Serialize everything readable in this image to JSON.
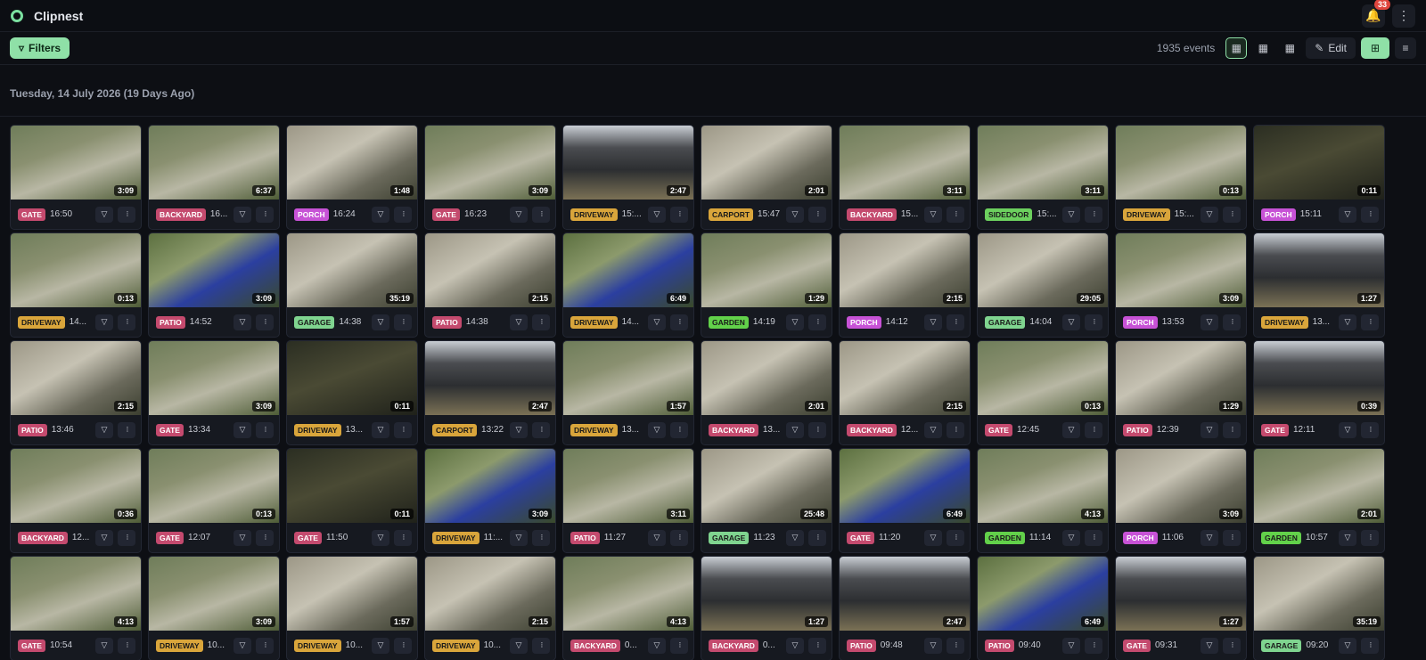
{
  "app": {
    "title": "Clipnest",
    "notification_count": "33"
  },
  "toolbar": {
    "filters_label": "Filters",
    "event_count": "1935 events",
    "edit_label": "Edit"
  },
  "date_heading": "Tuesday, 14 July 2026 (19 Days Ago)",
  "tag_colors": {
    "GATE": "#c44a6e",
    "BACKYARD": "#c44a6e",
    "PATIO": "#c44a6e",
    "PORCH": "#c752d6",
    "DRIVEWAY": "#d9a53b",
    "CARPORT": "#d9a53b",
    "SIDEDOOR": "#6cd05e",
    "GARAGE": "#7fd48f",
    "GARDEN": "#62d14a"
  },
  "events": [
    {
      "tag": "GATE",
      "time": "16:50",
      "duration": "3:09",
      "scene": "trail"
    },
    {
      "tag": "BACKYARD",
      "time": "16...",
      "duration": "6:37",
      "scene": "trail"
    },
    {
      "tag": "PORCH",
      "time": "16:24",
      "duration": "1:48",
      "scene": "yard"
    },
    {
      "tag": "GATE",
      "time": "16:23",
      "duration": "3:09",
      "scene": "trail"
    },
    {
      "tag": "DRIVEWAY",
      "time": "15:...",
      "duration": "2:47",
      "scene": "house"
    },
    {
      "tag": "CARPORT",
      "time": "15:47",
      "duration": "2:01",
      "scene": "yard"
    },
    {
      "tag": "BACKYARD",
      "time": "15...",
      "duration": "3:11",
      "scene": "trail"
    },
    {
      "tag": "SIDEDOOR",
      "time": "15:...",
      "duration": "3:11",
      "scene": "trail"
    },
    {
      "tag": "DRIVEWAY",
      "time": "15:...",
      "duration": "0:13",
      "scene": "trail"
    },
    {
      "tag": "PORCH",
      "time": "15:11",
      "duration": "0:11",
      "scene": "dark"
    },
    {
      "tag": "DRIVEWAY",
      "time": "14...",
      "duration": "0:13",
      "scene": "trail"
    },
    {
      "tag": "PATIO",
      "time": "14:52",
      "duration": "3:09",
      "scene": "car"
    },
    {
      "tag": "GARAGE",
      "time": "14:38",
      "duration": "35:19",
      "scene": "yard"
    },
    {
      "tag": "PATIO",
      "time": "14:38",
      "duration": "2:15",
      "scene": "yard"
    },
    {
      "tag": "DRIVEWAY",
      "time": "14...",
      "duration": "6:49",
      "scene": "car"
    },
    {
      "tag": "GARDEN",
      "time": "14:19",
      "duration": "1:29",
      "scene": "trail"
    },
    {
      "tag": "PORCH",
      "time": "14:12",
      "duration": "2:15",
      "scene": "yard"
    },
    {
      "tag": "GARAGE",
      "time": "14:04",
      "duration": "29:05",
      "scene": "yard"
    },
    {
      "tag": "PORCH",
      "time": "13:53",
      "duration": "3:09",
      "scene": "trail"
    },
    {
      "tag": "DRIVEWAY",
      "time": "13...",
      "duration": "1:27",
      "scene": "house"
    },
    {
      "tag": "PATIO",
      "time": "13:46",
      "duration": "2:15",
      "scene": "yard"
    },
    {
      "tag": "GATE",
      "time": "13:34",
      "duration": "3:09",
      "scene": "trail"
    },
    {
      "tag": "DRIVEWAY",
      "time": "13...",
      "duration": "0:11",
      "scene": "dark"
    },
    {
      "tag": "CARPORT",
      "time": "13:22",
      "duration": "2:47",
      "scene": "house"
    },
    {
      "tag": "DRIVEWAY",
      "time": "13...",
      "duration": "1:57",
      "scene": "trail"
    },
    {
      "tag": "BACKYARD",
      "time": "13...",
      "duration": "2:01",
      "scene": "yard"
    },
    {
      "tag": "BACKYARD",
      "time": "12...",
      "duration": "2:15",
      "scene": "yard"
    },
    {
      "tag": "GATE",
      "time": "12:45",
      "duration": "0:13",
      "scene": "trail"
    },
    {
      "tag": "PATIO",
      "time": "12:39",
      "duration": "1:29",
      "scene": "yard"
    },
    {
      "tag": "GATE",
      "time": "12:11",
      "duration": "0:39",
      "scene": "house"
    },
    {
      "tag": "BACKYARD",
      "time": "12...",
      "duration": "0:36",
      "scene": "trail"
    },
    {
      "tag": "GATE",
      "time": "12:07",
      "duration": "0:13",
      "scene": "trail"
    },
    {
      "tag": "GATE",
      "time": "11:50",
      "duration": "0:11",
      "scene": "dark"
    },
    {
      "tag": "DRIVEWAY",
      "time": "11:...",
      "duration": "3:09",
      "scene": "car"
    },
    {
      "tag": "PATIO",
      "time": "11:27",
      "duration": "3:11",
      "scene": "trail"
    },
    {
      "tag": "GARAGE",
      "time": "11:23",
      "duration": "25:48",
      "scene": "yard"
    },
    {
      "tag": "GATE",
      "time": "11:20",
      "duration": "6:49",
      "scene": "car"
    },
    {
      "tag": "GARDEN",
      "time": "11:14",
      "duration": "4:13",
      "scene": "trail"
    },
    {
      "tag": "PORCH",
      "time": "11:06",
      "duration": "3:09",
      "scene": "yard"
    },
    {
      "tag": "GARDEN",
      "time": "10:57",
      "duration": "2:01",
      "scene": "trail"
    },
    {
      "tag": "GATE",
      "time": "10:54",
      "duration": "4:13",
      "scene": "trail"
    },
    {
      "tag": "DRIVEWAY",
      "time": "10...",
      "duration": "3:09",
      "scene": "trail"
    },
    {
      "tag": "DRIVEWAY",
      "time": "10...",
      "duration": "1:57",
      "scene": "yard"
    },
    {
      "tag": "DRIVEWAY",
      "time": "10...",
      "duration": "2:15",
      "scene": "yard"
    },
    {
      "tag": "BACKYARD",
      "time": "0...",
      "duration": "4:13",
      "scene": "trail"
    },
    {
      "tag": "BACKYARD",
      "time": "0...",
      "duration": "1:27",
      "scene": "house"
    },
    {
      "tag": "PATIO",
      "time": "09:48",
      "duration": "2:47",
      "scene": "house"
    },
    {
      "tag": "PATIO",
      "time": "09:40",
      "duration": "6:49",
      "scene": "car"
    },
    {
      "tag": "GATE",
      "time": "09:31",
      "duration": "1:27",
      "scene": "house"
    },
    {
      "tag": "GARAGE",
      "time": "09:20",
      "duration": "35:19",
      "scene": "yard"
    }
  ],
  "icons": {
    "app": "ring-logo-icon",
    "bell": "bell-icon",
    "more": "more-vertical-icon",
    "filter": "filter-icon",
    "edit": "pencil-icon",
    "download": "download-icon",
    "info": "info-icon"
  }
}
